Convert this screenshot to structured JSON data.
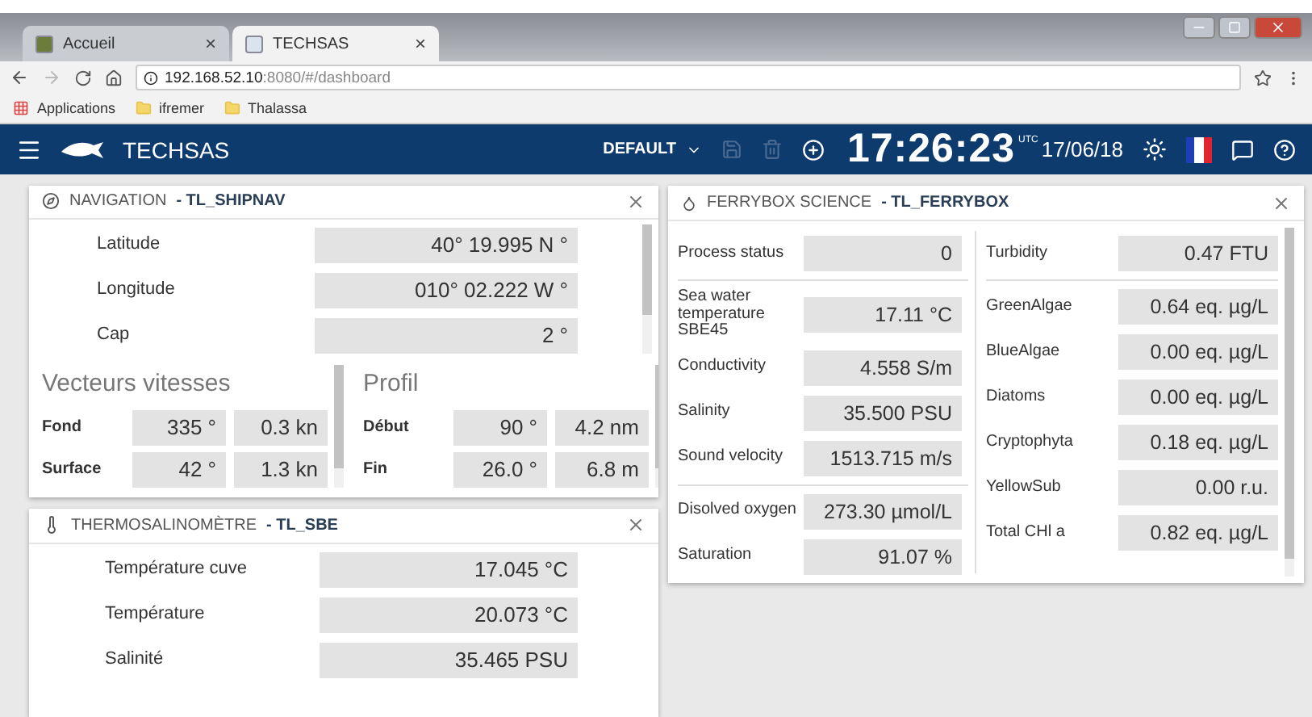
{
  "browser": {
    "tabs": [
      {
        "label": "Accueil",
        "close": "×",
        "selected": false
      },
      {
        "label": "TECHSAS",
        "close": "×",
        "selected": true
      }
    ],
    "url": {
      "host": "192.168.52.10",
      "rest": ":8080/#/dashboard"
    },
    "bookmarks": [
      {
        "label": "Applications",
        "kind": "apps"
      },
      {
        "label": "ifremer",
        "kind": "folder"
      },
      {
        "label": "Thalassa",
        "kind": "folder"
      }
    ]
  },
  "app_bar": {
    "title": "TECHSAS",
    "layout": "DEFAULT",
    "time": "17:26:23",
    "zone": "UTC",
    "date": "17/06/18"
  },
  "navigation": {
    "title": "NAVIGATION",
    "source": "- TL_SHIPNAV",
    "rows": [
      {
        "label": "Latitude",
        "value": "40° 19.995 N °"
      },
      {
        "label": "Longitude",
        "value": "010° 02.222 W °"
      },
      {
        "label": "Cap",
        "value": "2 °"
      }
    ],
    "sections": [
      {
        "heading": "Vecteurs vitesses",
        "rows": [
          {
            "label": "Fond",
            "values": [
              "335 °",
              "0.3 kn"
            ]
          },
          {
            "label": "Surface",
            "values": [
              "42 °",
              "1.3 kn"
            ]
          }
        ]
      },
      {
        "heading": "Profil",
        "rows": [
          {
            "label": "Début",
            "values": [
              "90 °",
              "4.2 nm"
            ]
          },
          {
            "label": "Fin",
            "values": [
              "26.0 °",
              "6.8 m"
            ]
          }
        ]
      }
    ]
  },
  "thermosalinometre": {
    "title": "THERMOSALINOMÈTRE",
    "source": "- TL_SBE",
    "rows": [
      {
        "label": "Température cuve",
        "value": "17.045 °C"
      },
      {
        "label": "Température",
        "value": "20.073 °C"
      },
      {
        "label": "Salinité",
        "value": "35.465 PSU"
      }
    ]
  },
  "ferrybox": {
    "title": "FERRYBOX SCIENCE",
    "source": "- TL_FERRYBOX",
    "left": [
      [
        {
          "label": "Process status",
          "value": "0"
        }
      ],
      [
        {
          "label": "Sea water temperature SBE45",
          "value": "17.11 °C"
        },
        {
          "label": "Conductivity",
          "value": "4.558 S/m"
        },
        {
          "label": "Salinity",
          "value": "35.500 PSU"
        },
        {
          "label": "Sound velocity",
          "value": "1513.715 m/s"
        }
      ],
      [
        {
          "label": "Disolved oxygen",
          "value": "273.30 µmol/L"
        },
        {
          "label": "Saturation",
          "value": "91.07 %"
        }
      ]
    ],
    "right": [
      [
        {
          "label": "Turbidity",
          "value": "0.47 FTU"
        }
      ],
      [
        {
          "label": "GreenAlgae",
          "value": "0.64 eq. µg/L"
        },
        {
          "label": "BlueAlgae",
          "value": "0.00 eq. µg/L"
        },
        {
          "label": "Diatoms",
          "value": "0.00 eq. µg/L"
        },
        {
          "label": "Cryptophyta",
          "value": "0.18 eq. µg/L"
        },
        {
          "label": "YellowSub",
          "value": "0.00 r.u."
        },
        {
          "label": "Total CHl a",
          "value": "0.82 eq. µg/L"
        }
      ]
    ]
  }
}
